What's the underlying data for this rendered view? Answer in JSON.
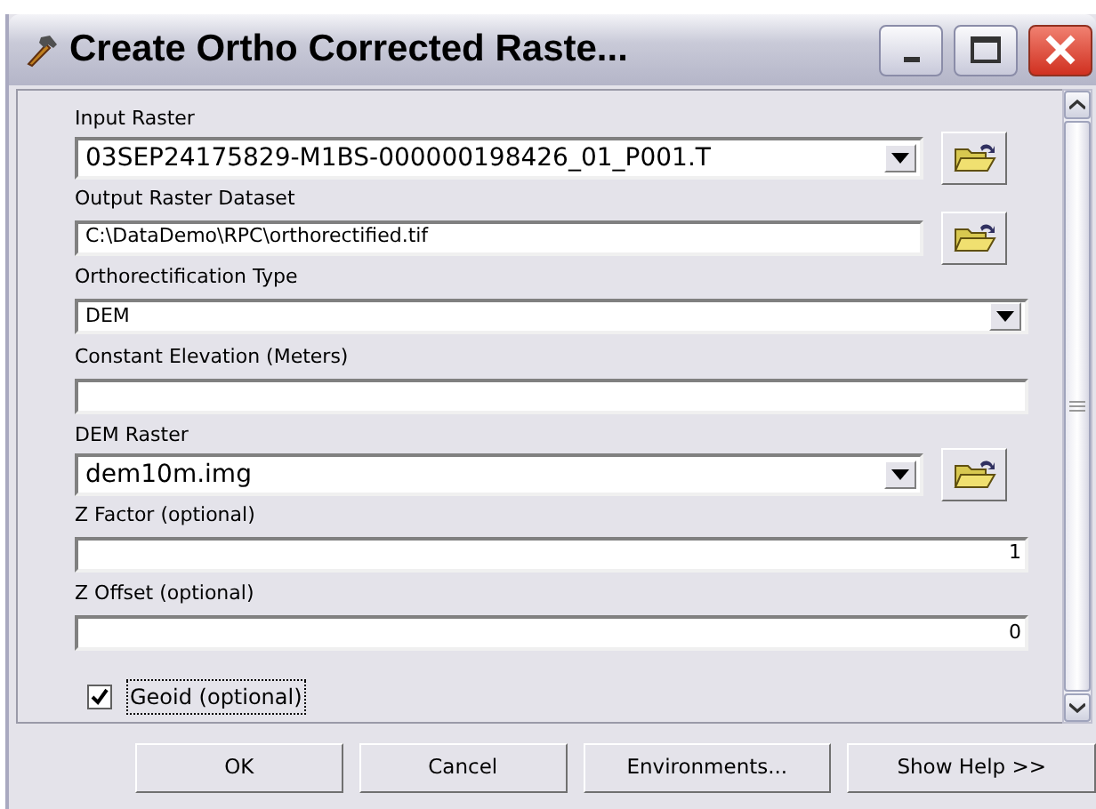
{
  "window": {
    "title": "Create Ortho Corrected Raste..."
  },
  "fields": [
    {
      "label": "Input Raster",
      "kind": "combo",
      "value": "03SEP24175829-M1BS-000000198426_01_P001.T",
      "browse": true
    },
    {
      "label": "Output Raster Dataset",
      "kind": "text",
      "value": "C:\\DataDemo\\RPC\\orthorectified.tif",
      "browse": true
    },
    {
      "label": "Orthorectification Type",
      "kind": "dropdown",
      "value": "DEM",
      "browse": false
    },
    {
      "label": "Constant Elevation (Meters)",
      "kind": "text",
      "browse": false
    },
    {
      "label": "DEM Raster",
      "kind": "combo",
      "value": "dem10m.img",
      "browse": true
    },
    {
      "label": "Z Factor (optional)",
      "kind": "number",
      "value": "1",
      "browse": false
    },
    {
      "label": "Z Offset (optional)",
      "kind": "number",
      "value": "0",
      "browse": false
    }
  ],
  "geoid": {
    "label": "Geoid (optional)",
    "checked": true
  },
  "buttons": [
    "OK",
    "Cancel",
    "Environments...",
    "Show Help >>"
  ]
}
